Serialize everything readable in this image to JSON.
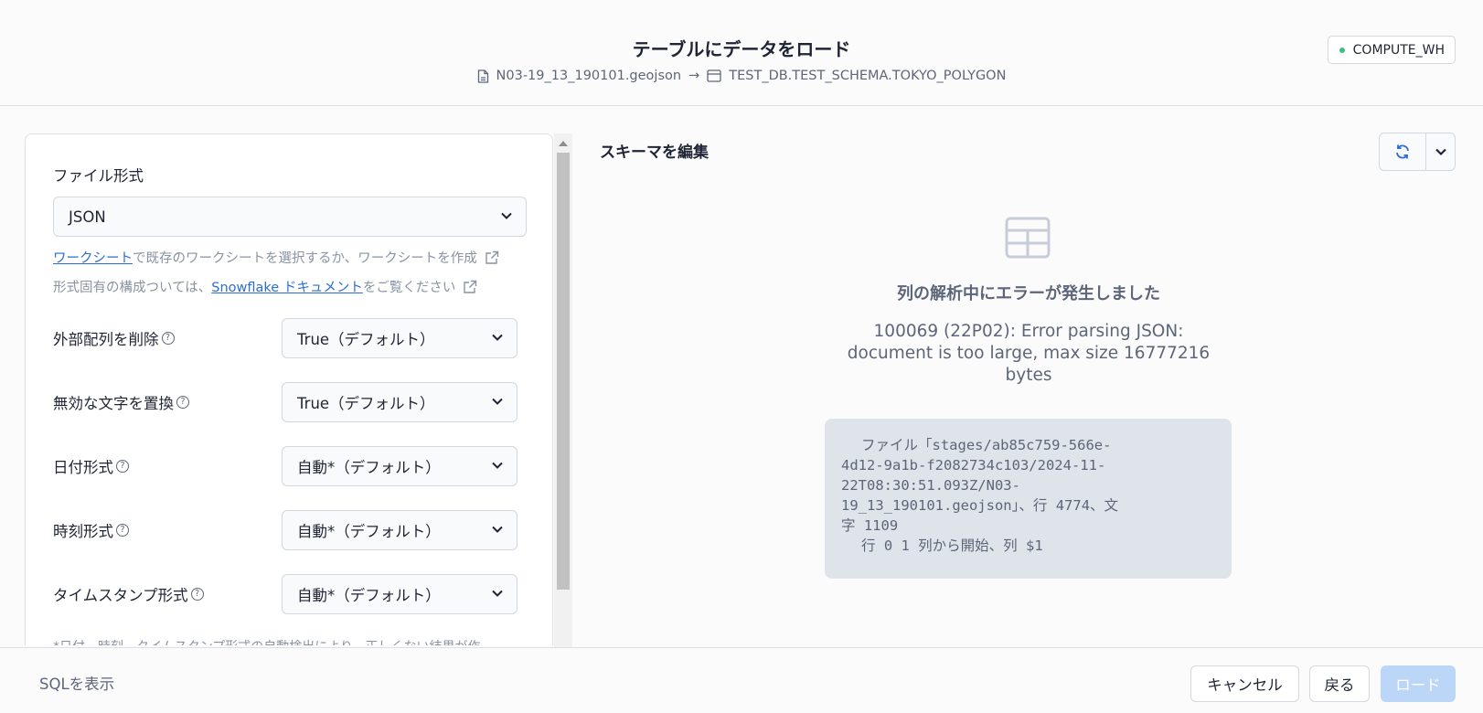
{
  "header": {
    "title": "テーブルにデータをロード",
    "source_file": "N03-19_13_190101.geojson",
    "arrow": "→",
    "target_table": "TEST_DB.TEST_SCHEMA.TOKYO_POLYGON",
    "warehouse": "COMPUTE_WH"
  },
  "left_panel": {
    "file_format_label": "ファイル形式",
    "file_format_value": "JSON",
    "hint1_link": "ワークシート",
    "hint1_text": " で既存のワークシートを選択するか、ワークシートを作成",
    "hint2_text": "形式固有の構成ついては、",
    "hint2_link": "Snowflake ドキュメント",
    "hint2_suffix": " をご覧ください",
    "options": [
      {
        "label": "外部配列を削除",
        "value": "True（デフォルト）"
      },
      {
        "label": "無効な文字を置換",
        "value": "True（デフォルト）"
      },
      {
        "label": "日付形式",
        "value": "自動*（デフォルト）"
      },
      {
        "label": "時刻形式",
        "value": "自動*（デフォルト）"
      },
      {
        "label": "タイムスタンプ形式",
        "value": "自動*（デフォルト）"
      }
    ],
    "help_glyph": "?",
    "footnote": "*日付、時刻、タイムスタンプ形式の自動検出により、正しくない結果が作"
  },
  "schema": {
    "title": "スキーマを編集",
    "error_title": "列の解析中にエラーが発生しました",
    "error_message": "100069 (22P02): Error parsing JSON: document is too large, max size 16777216 bytes",
    "error_detail_lines": [
      "ファイル「stages/ab85c759-566e-",
      "4d12-9a1b-f2082734c103/2024-11-",
      "22T08:30:51.093Z/N03-",
      "19_13_190101.geojson」、行 4774、文",
      "字 1109",
      "行 0 1 列から開始、列 $1"
    ]
  },
  "footer": {
    "show_sql": "SQLを表示",
    "cancel": "キャンセル",
    "back": "戻る",
    "load": "ロード"
  },
  "colors": {
    "accent": "#2a6fd6",
    "status_dot": "#3fbf7f",
    "load_disabled": "#bcd6f8"
  }
}
